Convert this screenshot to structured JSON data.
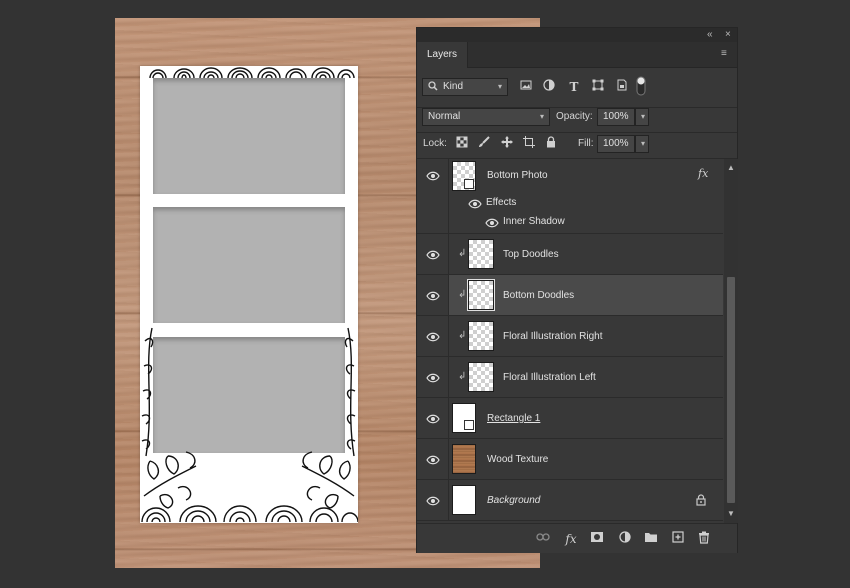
{
  "panel": {
    "tab_label": "Layers",
    "collapse_glyph": "«",
    "close_glyph": "×",
    "menu_glyph": "≡"
  },
  "filter": {
    "kind_label": "Kind",
    "icons": [
      "image-filter-icon",
      "adjustment-filter-icon",
      "type-filter-icon",
      "shape-filter-icon",
      "smart-object-filter-icon",
      "filter-toggle-icon"
    ]
  },
  "blend": {
    "mode": "Normal",
    "opacity_label": "Opacity:",
    "opacity_value": "100%"
  },
  "lock": {
    "label": "Lock:",
    "fill_label": "Fill:",
    "fill_value": "100%"
  },
  "layers": [
    {
      "name": "Bottom Photo",
      "fx": "fx",
      "effects_label": "Effects",
      "effect": "Inner Shadow"
    },
    {
      "name": "Top Doodles"
    },
    {
      "name": "Bottom Doodles"
    },
    {
      "name": "Floral Illustration Right"
    },
    {
      "name": "Floral Illustration Left"
    },
    {
      "name": "Rectangle 1"
    },
    {
      "name": "Wood Texture"
    },
    {
      "name": "Background"
    }
  ],
  "colors": {
    "app_bg": "#333333",
    "panel_bg": "#383838",
    "selected_row": "#4a4a4a",
    "photo_gray": "#b2b2b2"
  }
}
